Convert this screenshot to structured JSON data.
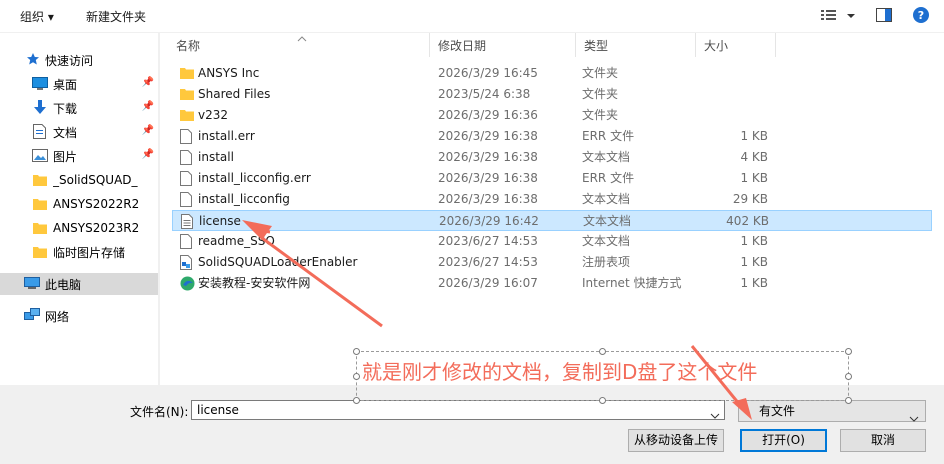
{
  "toolbar": {
    "organize_label": "组织 ▾",
    "new_folder_label": "新建文件夹"
  },
  "nav": {
    "quick_access": "快速访问",
    "items": [
      {
        "label": "桌面",
        "pinned": true
      },
      {
        "label": "下载",
        "pinned": true
      },
      {
        "label": "文档",
        "pinned": true
      },
      {
        "label": "图片",
        "pinned": true
      },
      {
        "label": "_SolidSQUAD_",
        "pinned": false
      },
      {
        "label": "ANSYS2022R2",
        "pinned": false
      },
      {
        "label": "ANSYS2023R2",
        "pinned": false
      },
      {
        "label": "临时图片存储",
        "pinned": false
      }
    ],
    "this_pc": "此电脑",
    "network": "网络"
  },
  "columns": {
    "name": "名称",
    "date": "修改日期",
    "type": "类型",
    "size": "大小"
  },
  "files": [
    {
      "name": "ANSYS Inc",
      "date": "2026/3/29 16:45",
      "type": "文件夹",
      "size": "",
      "icon": "folder"
    },
    {
      "name": "Shared Files",
      "date": "2023/5/24 6:38",
      "type": "文件夹",
      "size": "",
      "icon": "folder"
    },
    {
      "name": "v232",
      "date": "2026/3/29 16:36",
      "type": "文件夹",
      "size": "",
      "icon": "folder"
    },
    {
      "name": "install.err",
      "date": "2026/3/29 16:38",
      "type": "ERR 文件",
      "size": "1 KB",
      "icon": "file"
    },
    {
      "name": "install",
      "date": "2026/3/29 16:38",
      "type": "文本文档",
      "size": "4 KB",
      "icon": "file"
    },
    {
      "name": "install_licconfig.err",
      "date": "2026/3/29 16:38",
      "type": "ERR 文件",
      "size": "1 KB",
      "icon": "file"
    },
    {
      "name": "install_licconfig",
      "date": "2026/3/29 16:38",
      "type": "文本文档",
      "size": "29 KB",
      "icon": "file"
    },
    {
      "name": "license",
      "date": "2026/3/29 16:42",
      "type": "文本文档",
      "size": "402 KB",
      "icon": "text-file"
    },
    {
      "name": "readme_SSQ",
      "date": "2023/6/27 14:53",
      "type": "文本文档",
      "size": "1 KB",
      "icon": "file"
    },
    {
      "name": "SolidSQUADLoaderEnabler",
      "date": "2023/6/27 14:53",
      "type": "注册表项",
      "size": "1 KB",
      "icon": "reg-file"
    },
    {
      "name": "安装教程-安安软件网",
      "date": "2026/3/29 16:07",
      "type": "Internet 快捷方式",
      "size": "1 KB",
      "icon": "edge-link"
    }
  ],
  "selected_row_index": 7,
  "filename": {
    "label": "文件名(N):",
    "value": "license"
  },
  "filetype": {
    "value": "有文件"
  },
  "buttons": {
    "upload": "从移动设备上传",
    "open": "打开(O)",
    "cancel": "取消"
  },
  "annotation": {
    "text": "就是刚才修改的文档，复制到D盘了这个文件"
  },
  "colors": {
    "accent": "#0078d7",
    "selection": "#cce8ff",
    "annotation": "#f36c5a",
    "folder": "#ffc83d"
  }
}
